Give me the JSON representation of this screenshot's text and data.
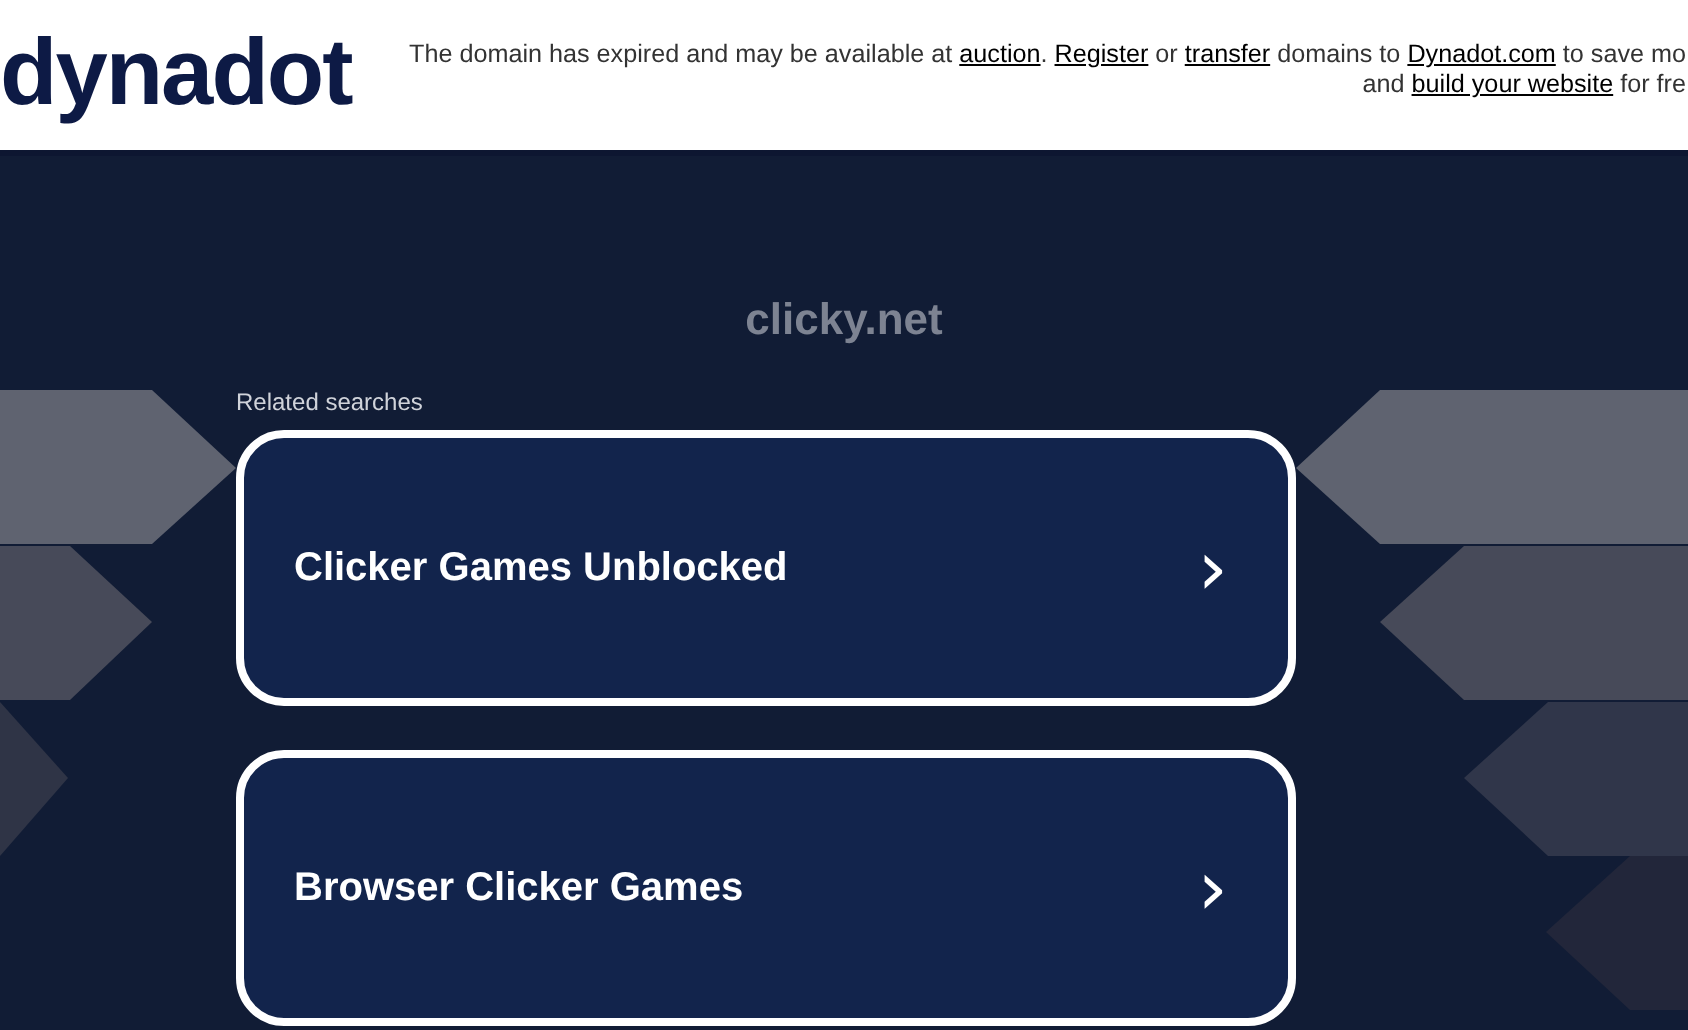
{
  "header": {
    "logo": "dynadot",
    "notice_lines": [
      [
        {
          "kind": "text",
          "text": "The domain has expired and may be available at "
        },
        {
          "kind": "link",
          "text": "auction"
        },
        {
          "kind": "text",
          "text": ". "
        },
        {
          "kind": "link",
          "text": "Register"
        },
        {
          "kind": "text",
          "text": " or "
        },
        {
          "kind": "link",
          "text": "transfer"
        },
        {
          "kind": "text",
          "text": " domains to "
        },
        {
          "kind": "link",
          "text": "Dynadot.com"
        },
        {
          "kind": "text",
          "text": " to save mo"
        }
      ],
      [
        {
          "kind": "text",
          "text": "and "
        },
        {
          "kind": "link",
          "text": "build your website"
        },
        {
          "kind": "text",
          "text": " for fre"
        }
      ]
    ]
  },
  "domain": "clicky.net",
  "related": {
    "label": "Related searches",
    "items": [
      {
        "text": "Clicker Games Unblocked",
        "chevron": "›"
      },
      {
        "text": "Browser Clicker Games",
        "chevron": "›"
      }
    ]
  }
}
